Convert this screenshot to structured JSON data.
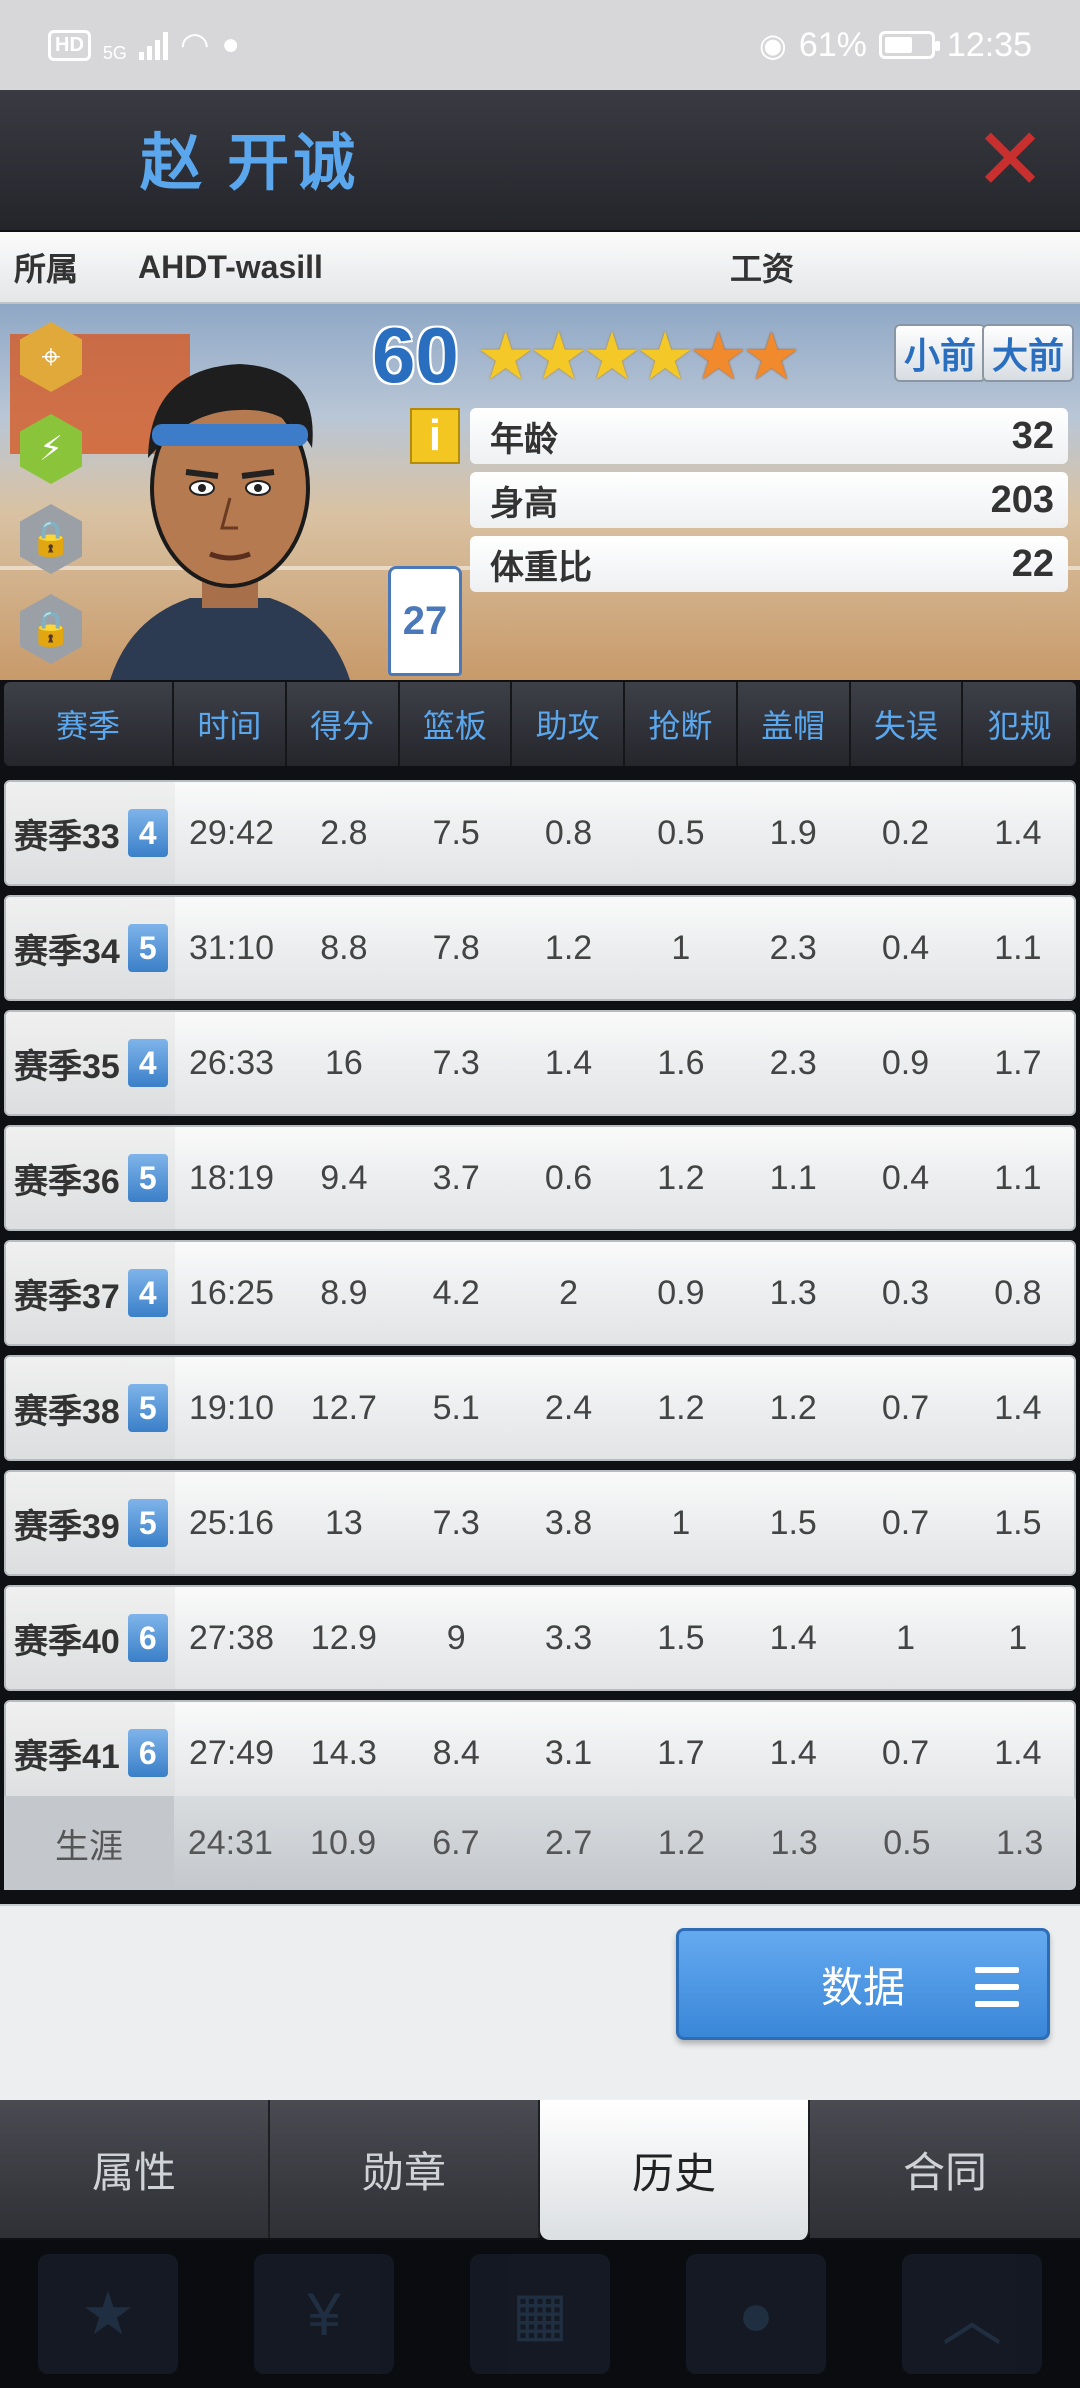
{
  "status_bar": {
    "hd": "HD",
    "net": "5G",
    "battery": "61%",
    "time": "12:35",
    "battery_level": 0.61
  },
  "header": {
    "player_name": "赵 开诚",
    "close_symbol": "✕"
  },
  "team_row": {
    "team_label": "所属",
    "team_name": "AHDT-wasill",
    "salary_label": "工资"
  },
  "player": {
    "rating": "60",
    "stars_gold": 4,
    "stars_orange": 2,
    "position_small": "小前",
    "position_big": "大前",
    "info_symbol": "i",
    "jersey_number": "27",
    "attributes": [
      {
        "label": "年龄",
        "value": "32"
      },
      {
        "label": "身高",
        "value": "203"
      },
      {
        "label": "体重比",
        "value": "22"
      }
    ]
  },
  "table": {
    "headers": [
      "赛季",
      "时间",
      "得分",
      "篮板",
      "助攻",
      "抢断",
      "盖帽",
      "失误",
      "犯规"
    ],
    "rows": [
      {
        "season": "赛季33",
        "lvl": "4",
        "vals": [
          "29:42",
          "2.8",
          "7.5",
          "0.8",
          "0.5",
          "1.9",
          "0.2",
          "1.4"
        ]
      },
      {
        "season": "赛季34",
        "lvl": "5",
        "vals": [
          "31:10",
          "8.8",
          "7.8",
          "1.2",
          "1",
          "2.3",
          "0.4",
          "1.1"
        ]
      },
      {
        "season": "赛季35",
        "lvl": "4",
        "vals": [
          "26:33",
          "16",
          "7.3",
          "1.4",
          "1.6",
          "2.3",
          "0.9",
          "1.7"
        ]
      },
      {
        "season": "赛季36",
        "lvl": "5",
        "vals": [
          "18:19",
          "9.4",
          "3.7",
          "0.6",
          "1.2",
          "1.1",
          "0.4",
          "1.1"
        ]
      },
      {
        "season": "赛季37",
        "lvl": "4",
        "vals": [
          "16:25",
          "8.9",
          "4.2",
          "2",
          "0.9",
          "1.3",
          "0.3",
          "0.8"
        ]
      },
      {
        "season": "赛季38",
        "lvl": "5",
        "vals": [
          "19:10",
          "12.7",
          "5.1",
          "2.4",
          "1.2",
          "1.2",
          "0.7",
          "1.4"
        ]
      },
      {
        "season": "赛季39",
        "lvl": "5",
        "vals": [
          "25:16",
          "13",
          "7.3",
          "3.8",
          "1",
          "1.5",
          "0.7",
          "1.5"
        ]
      },
      {
        "season": "赛季40",
        "lvl": "6",
        "vals": [
          "27:38",
          "12.9",
          "9",
          "3.3",
          "1.5",
          "1.4",
          "1",
          "1"
        ]
      },
      {
        "season": "赛季41",
        "lvl": "6",
        "vals": [
          "27:49",
          "14.3",
          "8.4",
          "3.1",
          "1.7",
          "1.4",
          "0.7",
          "1.4"
        ]
      }
    ],
    "career": {
      "label": "生涯",
      "vals": [
        "24:31",
        "10.9",
        "6.7",
        "2.7",
        "1.2",
        "1.3",
        "0.5",
        "1.3"
      ]
    }
  },
  "actions": {
    "data_button": "数据"
  },
  "tabs": [
    {
      "label": "属性",
      "active": false
    },
    {
      "label": "勋章",
      "active": false
    },
    {
      "label": "历史",
      "active": true
    },
    {
      "label": "合同",
      "active": false
    }
  ],
  "colors": {
    "accent_blue": "#5aa7ee",
    "close_red": "#c83030",
    "star_gold": "#f4c826",
    "star_orange": "#f08a2c"
  }
}
